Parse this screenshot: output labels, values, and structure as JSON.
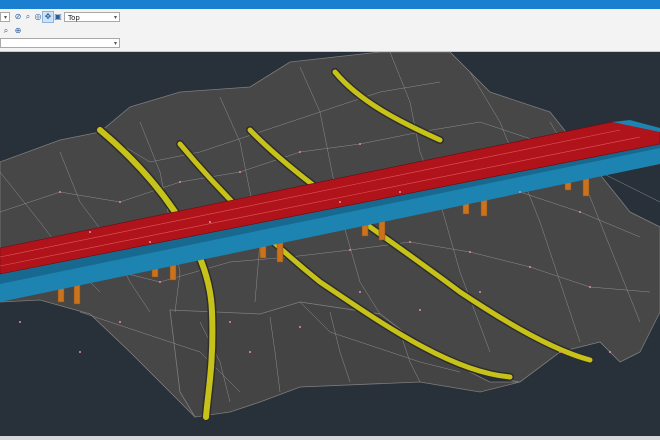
{
  "toolbar": {
    "row1": {
      "view_dropdown_value": "Top",
      "left_dropdown_value": ""
    },
    "row3": {
      "layer_dropdown_value": ""
    }
  },
  "icons": {
    "row1": [
      "zoom-icon",
      "zoom-window-icon",
      "orbit-icon",
      "pan-view-icon",
      "camera-icon"
    ],
    "row2": [
      "zoom-extents-icon",
      "compass-icon"
    ]
  },
  "colors": {
    "title_bar": "#1b7fd1",
    "terrain_fill": "#4a4a4a",
    "mesh_line": "#8f8f8f",
    "deck_top": "#b1131b",
    "deck_side": "#1d83b0",
    "pier": "#c9731f",
    "lane_stripe": "#c7c21a",
    "vertex": "#e88ab0"
  }
}
